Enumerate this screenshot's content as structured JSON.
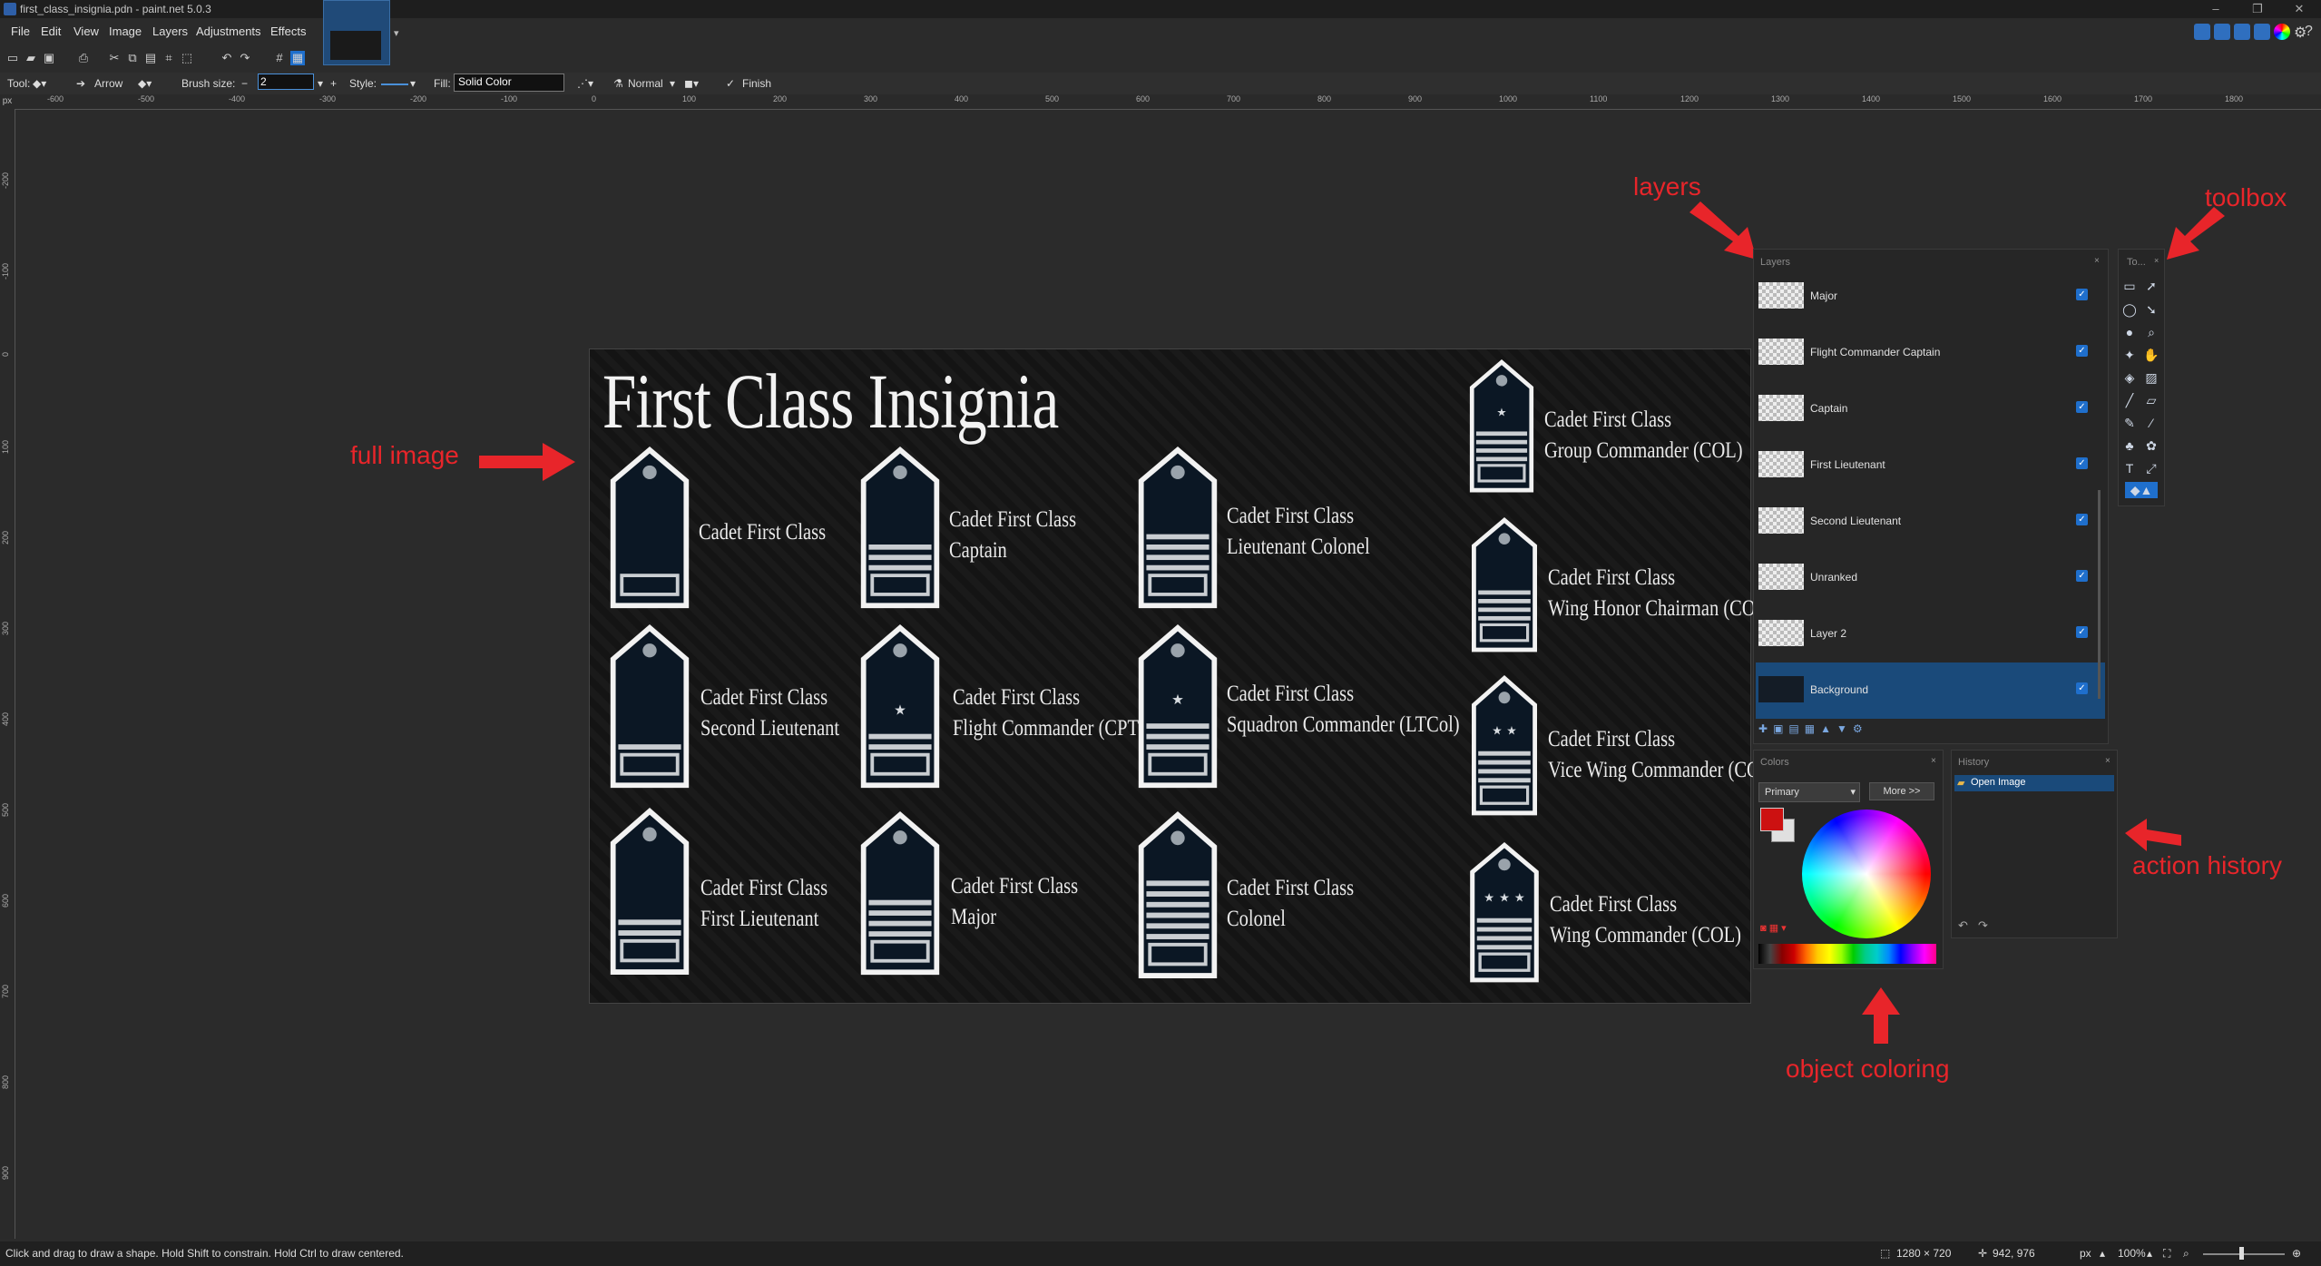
{
  "window": {
    "title": "first_class_insignia.pdn - paint.net 5.0.3"
  },
  "menu": [
    "File",
    "Edit",
    "View",
    "Image",
    "Layers",
    "Adjustments",
    "Effects"
  ],
  "tool_options": {
    "tool_label": "Tool:",
    "arrow_label": "Arrow",
    "brush_size_label": "Brush size:",
    "brush_size_value": "2",
    "style_label": "Style:",
    "fill_label": "Fill:",
    "fill_value": "Solid Color",
    "blend_mode": "Normal",
    "finish_label": "Finish"
  },
  "ruler": {
    "unit": "px",
    "h_ticks": [
      "-600",
      "-500",
      "-400",
      "-300",
      "-200",
      "-100",
      "0",
      "100",
      "200",
      "300",
      "400",
      "500",
      "600",
      "700",
      "800",
      "900",
      "1000",
      "1100",
      "1200",
      "1300",
      "1400",
      "1500",
      "1600",
      "1700",
      "1800"
    ],
    "v_ticks": [
      "-200",
      "-100",
      "0",
      "100",
      "200",
      "300",
      "400",
      "500",
      "600",
      "700",
      "800",
      "900"
    ]
  },
  "canvas": {
    "title": "First Class Insignia",
    "insignia": [
      {
        "line1": "Cadet First Class",
        "line2": ""
      },
      {
        "line1": "Cadet First Class",
        "line2": "Captain"
      },
      {
        "line1": "Cadet First Class",
        "line2": "Lieutenant Colonel"
      },
      {
        "line1": "Cadet First Class",
        "line2": "Group Commander (COL)"
      },
      {
        "line1": "Cadet First Class",
        "line2": "Second Lieutenant"
      },
      {
        "line1": "Cadet First Class",
        "line2": "Flight Commander (CPT)"
      },
      {
        "line1": "Cadet First Class",
        "line2": "Squadron Commander (LTCol)"
      },
      {
        "line1": "Cadet First Class",
        "line2": "Wing Honor Chairman (COL)"
      },
      {
        "line1": "Cadet First Class",
        "line2": "First Lieutenant"
      },
      {
        "line1": "Cadet First Class",
        "line2": "Major"
      },
      {
        "line1": "Cadet First Class",
        "line2": "Colonel"
      },
      {
        "line1": "Cadet First Class",
        "line2": "Vice Wing Commander (COL)"
      },
      {
        "line1": "Cadet First Class",
        "line2": "Wing Commander (COL)"
      }
    ]
  },
  "annotations": {
    "full_image": "full image",
    "layers": "layers",
    "toolbox": "toolbox",
    "action_history": "action history",
    "object_coloring": "object coloring"
  },
  "layers_panel": {
    "title": "Layers",
    "items": [
      {
        "name": "Major"
      },
      {
        "name": "Flight Commander Captain"
      },
      {
        "name": "Captain"
      },
      {
        "name": "First Lieutenant"
      },
      {
        "name": "Second Lieutenant"
      },
      {
        "name": "Unranked"
      },
      {
        "name": "Layer 2"
      },
      {
        "name": "Background",
        "selected": true
      }
    ]
  },
  "toolbox_panel": {
    "title": "To..."
  },
  "colors_panel": {
    "title": "Colors",
    "mode": "Primary",
    "more_label": "More >>",
    "primary_color": "#cc1111",
    "secondary_color": "#e0e0e0"
  },
  "history_panel": {
    "title": "History",
    "items": [
      "Open Image"
    ]
  },
  "status": {
    "hint": "Click and drag to draw a shape. Hold Shift to constrain. Hold Ctrl to draw centered.",
    "image_size": "1280 × 720",
    "cursor": "942, 976",
    "unit": "px",
    "zoom": "100%"
  },
  "colors": {
    "accent": "#1f6fcc",
    "annotation": "#e8252a",
    "selection": "#1a4a7a"
  }
}
